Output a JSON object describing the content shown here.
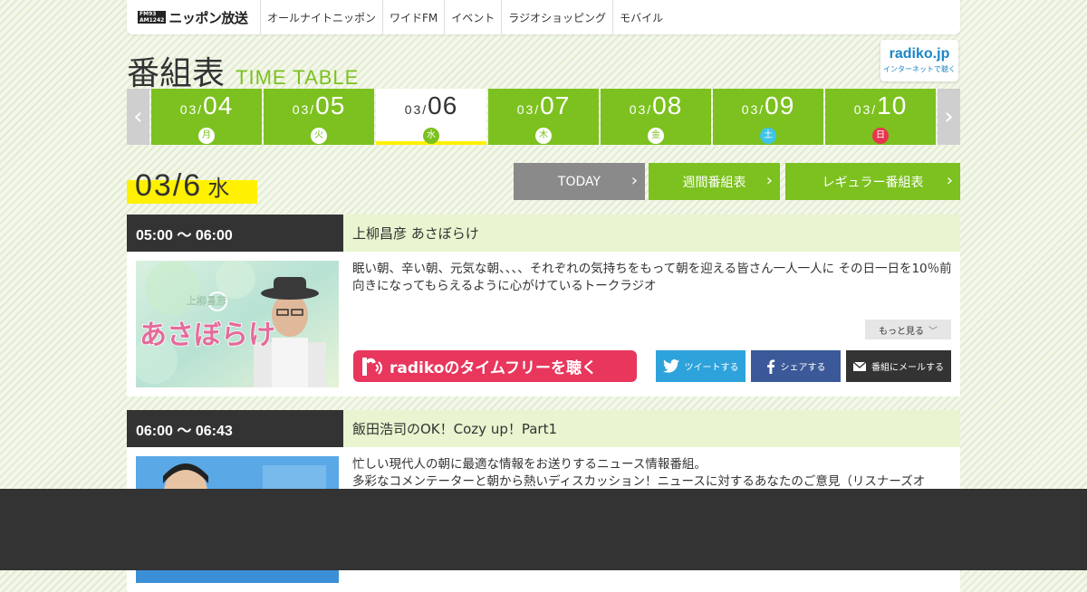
{
  "nav": {
    "logo_badge_1": "FM93",
    "logo_badge_2": "AM1242",
    "logo_text": "ニッポン放送",
    "links": [
      "オールナイトニッポン",
      "ワイドFM",
      "イベント",
      "ラジオショッピング",
      "モバイル"
    ]
  },
  "header": {
    "title_ja": "番組表",
    "title_en": "TIME TABLE",
    "radiko_logo": "radiko.jp",
    "radiko_sub": "インターネットで聴く"
  },
  "dates": [
    {
      "m": "03/",
      "d": "04",
      "wd": "月"
    },
    {
      "m": "03/",
      "d": "05",
      "wd": "火"
    },
    {
      "m": "03/",
      "d": "06",
      "wd": "水"
    },
    {
      "m": "03/",
      "d": "07",
      "wd": "木"
    },
    {
      "m": "03/",
      "d": "08",
      "wd": "金"
    },
    {
      "m": "03/",
      "d": "09",
      "wd": "土"
    },
    {
      "m": "03/",
      "d": "10",
      "wd": "日"
    }
  ],
  "selected_date_index": 2,
  "current": {
    "date": "03/6",
    "weekday": "水"
  },
  "buttons": {
    "today": "TODAY",
    "weekly": "週間番組表",
    "regular": "レギュラー番組表"
  },
  "programs": [
    {
      "time": "05:00 ～ 06:00",
      "title": "上柳昌彦 あさぼらけ",
      "description": "眠い朝、辛い朝、元気な朝、、、、それぞれの気持ちをもって朝を迎える皆さん一人一人に その日一日を10％前向きになってもらえるように心がけているトークラジオ",
      "thumb_text": "あさぼらけ",
      "thumb_small": "上柳昌彦",
      "more": "もっと見る",
      "radiko": "radikoのタイムフリーを聴く",
      "tweet": "ツイートする",
      "share": "シェアする",
      "mail": "番組にメールする"
    },
    {
      "time": "06:00 ～ 06:43",
      "title": "飯田浩司のOK！Cozy up！Part1",
      "description_1": "忙しい現代人の朝に最適な情報をお送りするニュース情報番組。",
      "description_2": "多彩なコメンテーターと朝から熱いディスカッション！ニュースに対するあなたのご意見（リスナーズオ"
    }
  ],
  "colors": {
    "green": "#7cc11f",
    "yellow": "#fff100",
    "dark": "#333333",
    "radiko_pink": "#e8365d",
    "twitter": "#2ea2db",
    "facebook": "#3b5998"
  }
}
